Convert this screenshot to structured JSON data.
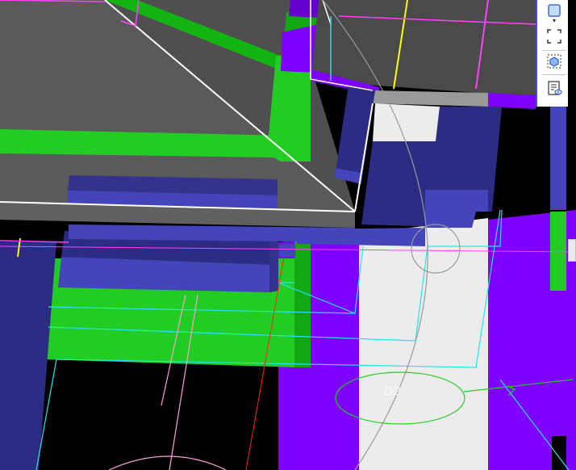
{
  "app": {
    "view_type": "3d-building-model-viewport"
  },
  "viewport": {
    "room_tag_text": "D2",
    "colors": {
      "background": "#000000",
      "slab_gray": "#5a5a5a",
      "slab_dark": "#4a4a4a",
      "green_wall": "#22cc22",
      "green_dark": "#12a812",
      "blue_beam": "#4444bb",
      "blue_dark": "#2c2c84",
      "purple_floor": "#7f00ff",
      "white_floor": "#ececec",
      "cyan_line": "#22e5ee",
      "magenta_line": "#ff40ff",
      "yellow_line": "#ffff00",
      "red_line": "#ff2020"
    }
  },
  "toolbar": {
    "tools": [
      {
        "name": "view-cube-icon",
        "tooltip": ""
      },
      {
        "name": "fit-view-icon",
        "tooltip": ""
      },
      {
        "name": "isolate-3d-icon",
        "tooltip": ""
      },
      {
        "name": "properties-visibility-icon",
        "tooltip": ""
      }
    ],
    "dropdown_caret": "▾"
  }
}
